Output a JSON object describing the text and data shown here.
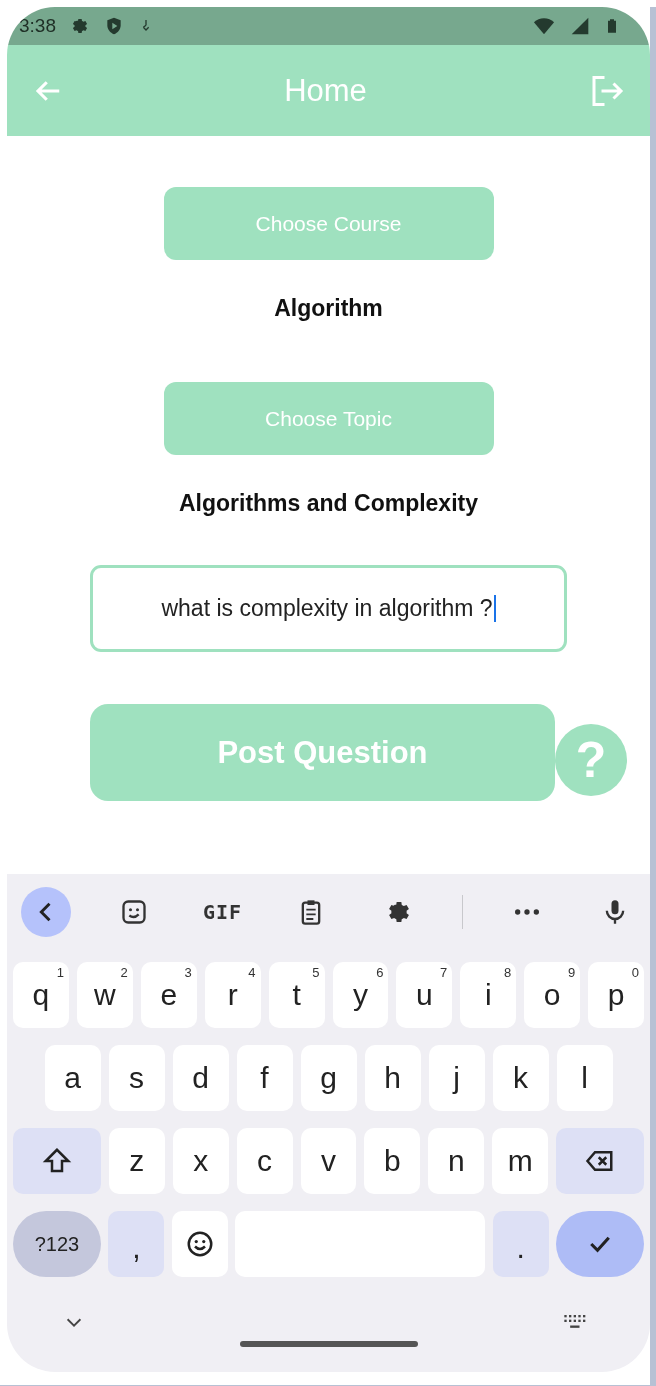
{
  "status_bar": {
    "time": "3:38"
  },
  "app_bar": {
    "title": "Home"
  },
  "course": {
    "button": "Choose Course",
    "value": "Algorithm"
  },
  "topic": {
    "button": "Choose Topic",
    "value": "Algorithms and Complexity"
  },
  "question_field": {
    "value": "what is complexity in algorithm ?",
    "focused": true
  },
  "post_button": {
    "label": "Post Question",
    "badge": "?"
  },
  "keyboard": {
    "toolbar": [
      {
        "kind": "back",
        "selected": true
      },
      {
        "kind": "sticker"
      },
      {
        "kind": "gif",
        "label": "GIF"
      },
      {
        "kind": "clipboard"
      },
      {
        "kind": "settings"
      },
      {
        "kind": "divider"
      },
      {
        "kind": "more"
      },
      {
        "kind": "mic"
      }
    ],
    "rows": [
      {
        "keys": [
          {
            "kind": "letter",
            "label": "q",
            "hint": "1"
          },
          {
            "kind": "letter",
            "label": "w",
            "hint": "2"
          },
          {
            "kind": "letter",
            "label": "e",
            "hint": "3"
          },
          {
            "kind": "letter",
            "label": "r",
            "hint": "4"
          },
          {
            "kind": "letter",
            "label": "t",
            "hint": "5"
          },
          {
            "kind": "letter",
            "label": "y",
            "hint": "6"
          },
          {
            "kind": "letter",
            "label": "u",
            "hint": "7"
          },
          {
            "kind": "letter",
            "label": "i",
            "hint": "8"
          },
          {
            "kind": "letter",
            "label": "o",
            "hint": "9"
          },
          {
            "kind": "letter",
            "label": "p",
            "hint": "0"
          }
        ]
      },
      {
        "keys": [
          {
            "kind": "letter",
            "label": "a"
          },
          {
            "kind": "letter",
            "label": "s"
          },
          {
            "kind": "letter",
            "label": "d"
          },
          {
            "kind": "letter",
            "label": "f"
          },
          {
            "kind": "letter",
            "label": "g"
          },
          {
            "kind": "letter",
            "label": "h"
          },
          {
            "kind": "letter",
            "label": "j"
          },
          {
            "kind": "letter",
            "label": "k"
          },
          {
            "kind": "letter",
            "label": "l"
          }
        ]
      },
      {
        "keys": [
          {
            "kind": "shift"
          },
          {
            "kind": "letter",
            "label": "z"
          },
          {
            "kind": "letter",
            "label": "x"
          },
          {
            "kind": "letter",
            "label": "c"
          },
          {
            "kind": "letter",
            "label": "v"
          },
          {
            "kind": "letter",
            "label": "b"
          },
          {
            "kind": "letter",
            "label": "n"
          },
          {
            "kind": "letter",
            "label": "m"
          },
          {
            "kind": "backspace"
          }
        ]
      },
      {
        "keys": [
          {
            "kind": "symbols",
            "label": "?123"
          },
          {
            "kind": "punct",
            "label": ","
          },
          {
            "kind": "emoji"
          },
          {
            "kind": "space"
          },
          {
            "kind": "punct",
            "label": "."
          },
          {
            "kind": "done"
          }
        ]
      }
    ]
  }
}
